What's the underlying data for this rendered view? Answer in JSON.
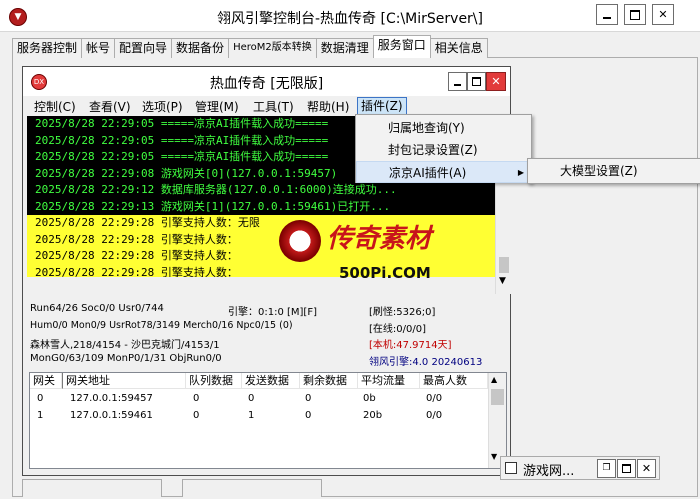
{
  "outer": {
    "title": "翎风引擎控制台-热血传奇 [C:\\MirServer\\]",
    "app_icon": "legend-logo-icon"
  },
  "tabs": [
    "服务器控制",
    "帐号",
    "配置向导",
    "数据备份",
    "HeroM2版本转换",
    "数据清理",
    "服务窗口",
    "相关信息"
  ],
  "active_tab": "服务窗口",
  "inner": {
    "title": "热血传奇 [无限版]",
    "menus": [
      "控制(C)",
      "查看(V)",
      "选项(P)",
      "管理(M)",
      "工具(T)",
      "帮助(H)",
      "插件(Z)"
    ]
  },
  "log_lines": [
    {
      "text": "2025/8/28 22:29:05 =====凉京AI插件载入成功=====",
      "highlight": false
    },
    {
      "text": "2025/8/28 22:29:05 =====凉京AI插件载入成功=====",
      "highlight": false
    },
    {
      "text": "2025/8/28 22:29:05 =====凉京AI插件载入成功=====",
      "highlight": false
    },
    {
      "text": "2025/8/28 22:29:08 游戏网关[0](127.0.0.1:59457)",
      "highlight": false
    },
    {
      "text": "2025/8/28 22:29:12 数据库服务器(127.0.0.1:6000)连接成功...",
      "highlight": false
    },
    {
      "text": "2025/8/28 22:29:13 游戏网关[1](127.0.0.1:59461)已打开...",
      "highlight": false
    },
    {
      "text": "2025/8/28 22:29:28 引擎支持人数：无限",
      "highlight": true
    },
    {
      "text": "2025/8/28 22:29:28 引擎支持人数：",
      "highlight": true
    },
    {
      "text": "2025/8/28 22:29:28 引擎支持人数：",
      "highlight": true
    },
    {
      "text": "2025/8/28 22:29:28 引擎支持人数：",
      "highlight": true
    }
  ],
  "watermark": {
    "brand": "传奇素材",
    "site": "500Pi.COM",
    "logo": "500pi-logo"
  },
  "status": {
    "row1_left": "Run64/26 Soc0/0 Usr0/744",
    "row1_mid": "引擎：0:1:0 [M][F]",
    "row1_right": "[刷怪:5326;0]",
    "row2_left": "Hum0/0 Mon0/9 UsrRot78/3149 Merch0/16 Npc0/15 (0)",
    "row2_right": "[在线:0/0/0]",
    "row3_left": "森林雪人,218/4154 - 沙巴克城门/4153/1",
    "row3_right": "[本机:47.9714天]",
    "row4_left": "MonG0/63/109 MonP0/1/31 ObjRun0/0",
    "row4_right": "翎风引擎:4.0 20240613",
    "color_red": "#c00000",
    "color_blue": "#000080"
  },
  "gateway_table": {
    "headers": [
      "网关",
      "网关地址",
      "队列数据",
      "发送数据",
      "剩余数据",
      "平均流量",
      "最高人数"
    ],
    "rows": [
      [
        "0",
        "127.0.0.1:59457",
        "0",
        "0",
        "0",
        "0b",
        "0/0"
      ],
      [
        "1",
        "127.0.0.1:59461",
        "0",
        "1",
        "0",
        "20b",
        "0/0"
      ]
    ]
  },
  "plugin_menu": {
    "items": [
      "归属地查询(Y)",
      "封包记录设置(Z)",
      "凉京AI插件(A)"
    ],
    "selected": "凉京AI插件(A)",
    "submenu_items": [
      "大模型设置(Z)"
    ]
  },
  "bottom": {
    "game_window_title": "游戏网..."
  }
}
